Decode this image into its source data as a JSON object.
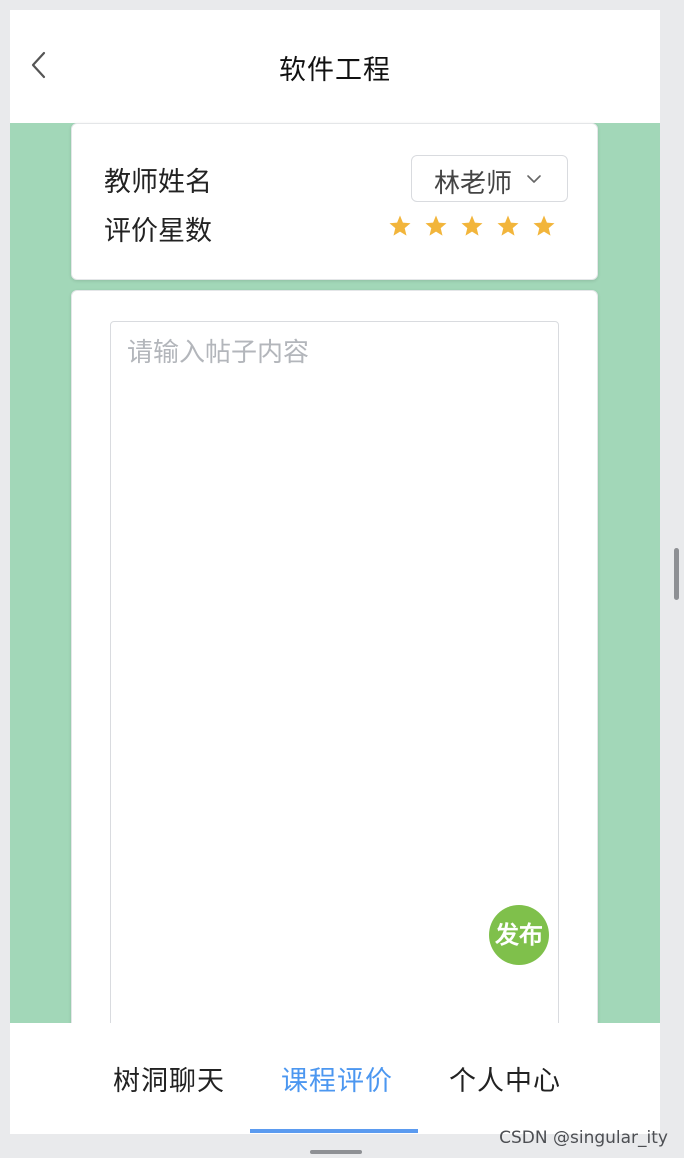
{
  "header": {
    "title": "软件工程",
    "back_icon": "chevron-left-icon"
  },
  "info_card": {
    "teacher_label": "教师姓名",
    "teacher_value": "林老师",
    "dropdown_icon": "chevron-down-icon",
    "rating_label": "评价星数",
    "rating_value": 5,
    "rating_max": 5,
    "star_color": "#f2b53b"
  },
  "post": {
    "placeholder": "请输入帖子内容",
    "value": "",
    "publish_label": "发布",
    "publish_color": "#7fc04b"
  },
  "tabs": [
    {
      "label": "树洞聊天",
      "active": false
    },
    {
      "label": "课程评价",
      "active": true
    },
    {
      "label": "个人中心",
      "active": false
    }
  ],
  "colors": {
    "background_green": "#a2d7b8",
    "active_tab": "#4c97f0"
  },
  "watermark": "CSDN @singular_ity"
}
